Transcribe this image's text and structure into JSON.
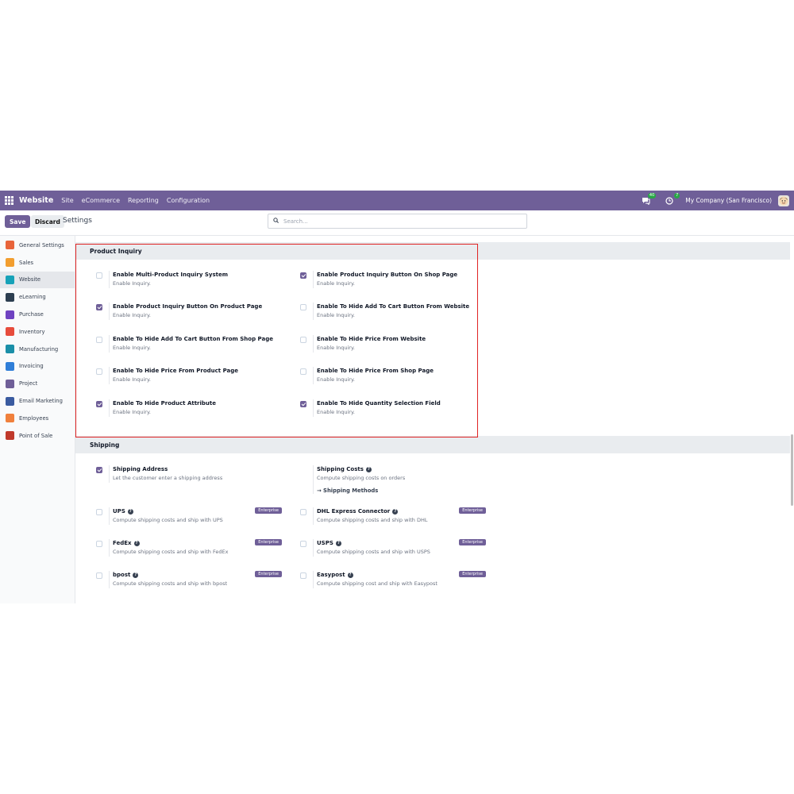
{
  "navbar": {
    "brand": "Website",
    "menu": [
      "Site",
      "eCommerce",
      "Reporting",
      "Configuration"
    ],
    "chat_count": "40",
    "activity_count": "7",
    "company": "My Company (San Francisco)"
  },
  "control_panel": {
    "save_label": "Save",
    "discard_label": "Discard",
    "title": "Settings",
    "search_placeholder": "Search..."
  },
  "sidebar": {
    "items": [
      {
        "label": "General Settings",
        "color": "#e8643a"
      },
      {
        "label": "Sales",
        "color": "#f29e2f"
      },
      {
        "label": "Website",
        "color": "#17a2b8",
        "active": true
      },
      {
        "label": "eLearning",
        "color": "#2c3e50"
      },
      {
        "label": "Purchase",
        "color": "#6f42c1"
      },
      {
        "label": "Inventory",
        "color": "#e74c3c"
      },
      {
        "label": "Manufacturing",
        "color": "#1a8fa8"
      },
      {
        "label": "Invoicing",
        "color": "#2f7ed8"
      },
      {
        "label": "Project",
        "color": "#6f5f98"
      },
      {
        "label": "Email Marketing",
        "color": "#3a5ba0"
      },
      {
        "label": "Employees",
        "color": "#f0803c"
      },
      {
        "label": "Point of Sale",
        "color": "#c0392b"
      }
    ]
  },
  "product_inquiry": {
    "title": "Product Inquiry",
    "settings": [
      {
        "label": "Enable Multi-Product Inquiry System",
        "desc": "Enable Inquiry.",
        "checked": false
      },
      {
        "label": "Enable Product Inquiry Button On Shop Page",
        "desc": "Enable Inquiry.",
        "checked": true
      },
      {
        "label": "Enable Product Inquiry Button On Product Page",
        "desc": "Enable Inquiry.",
        "checked": true
      },
      {
        "label": "Enable To Hide Add To Cart Button From Website",
        "desc": "Enable Inquiry.",
        "checked": false
      },
      {
        "label": "Enable To Hide Add To Cart Button From Shop Page",
        "desc": "Enable Inquiry.",
        "checked": false
      },
      {
        "label": "Enable To Hide Price From Website",
        "desc": "Enable Inquiry.",
        "checked": false
      },
      {
        "label": "Enable To Hide Price From Product Page",
        "desc": "Enable Inquiry.",
        "checked": false
      },
      {
        "label": "Enable To Hide Price From Shop Page",
        "desc": "Enable Inquiry.",
        "checked": false
      },
      {
        "label": "Enable To Hide Product Attribute",
        "desc": "Enable Inquiry.",
        "checked": true
      },
      {
        "label": "Enable To Hide Quantity Selection Field",
        "desc": "Enable Inquiry.",
        "checked": true
      }
    ]
  },
  "shipping": {
    "title": "Shipping",
    "address": {
      "label": "Shipping Address",
      "desc": "Let the customer enter a shipping address",
      "checked": true
    },
    "costs": {
      "label": "Shipping Costs",
      "desc": "Compute shipping costs on orders",
      "link": "→ Shipping Methods"
    },
    "enterprise_label": "Enterprise",
    "connectors": [
      {
        "label": "UPS",
        "desc": "Compute shipping costs and ship with UPS"
      },
      {
        "label": "DHL Express Connector",
        "desc": "Compute shipping costs and ship with DHL"
      },
      {
        "label": "FedEx",
        "desc": "Compute shipping costs and ship with FedEx"
      },
      {
        "label": "USPS",
        "desc": "Compute shipping costs and ship with USPS"
      },
      {
        "label": "bpost",
        "desc": "Compute shipping costs and ship with bpost"
      },
      {
        "label": "Easypost",
        "desc": "Compute shipping cost and ship with Easypost"
      }
    ]
  }
}
